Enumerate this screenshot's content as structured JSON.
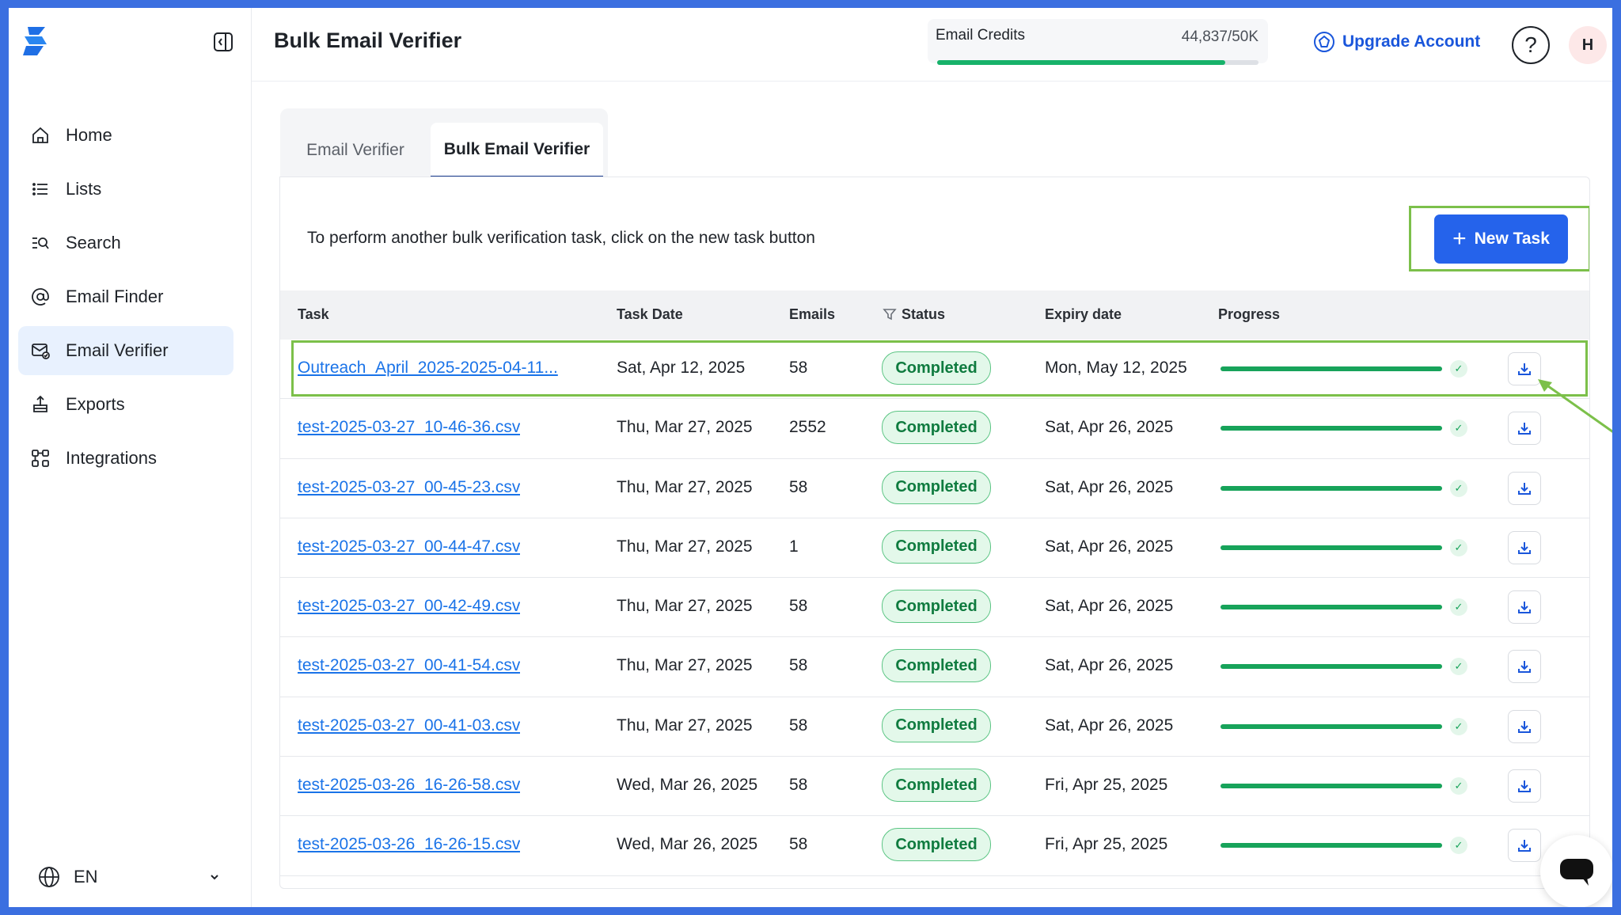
{
  "header": {
    "title": "Bulk Email Verifier",
    "credits_label": "Email Credits",
    "credits_value": "44,837/50K",
    "credits_fraction": 0.897,
    "upgrade_label": "Upgrade Account",
    "help_label": "?",
    "avatar_initial": "H"
  },
  "sidebar": {
    "items": [
      {
        "label": "Home",
        "icon": "home-icon"
      },
      {
        "label": "Lists",
        "icon": "list-icon"
      },
      {
        "label": "Search",
        "icon": "search-icon"
      },
      {
        "label": "Email Finder",
        "icon": "at-sign-icon"
      },
      {
        "label": "Email Verifier",
        "icon": "mail-check-icon",
        "active": true
      },
      {
        "label": "Exports",
        "icon": "export-icon"
      },
      {
        "label": "Integrations",
        "icon": "integrations-icon"
      }
    ],
    "language": "EN"
  },
  "tabs": [
    {
      "label": "Email Verifier",
      "active": false
    },
    {
      "label": "Bulk Email Verifier",
      "active": true
    }
  ],
  "main": {
    "intro_text": "To perform another bulk verification task, click on the new task button",
    "new_task_label": "New Task"
  },
  "table": {
    "columns": [
      "Task",
      "Task Date",
      "Emails",
      "Status",
      "Expiry date",
      "Progress"
    ],
    "rows": [
      {
        "task": "Outreach_April_2025-2025-04-11...",
        "date": "Sat, Apr 12, 2025",
        "emails": "58",
        "status": "Completed",
        "expiry": "Mon, May 12, 2025",
        "progress": 1.0
      },
      {
        "task": "test-2025-03-27_10-46-36.csv",
        "date": "Thu, Mar 27, 2025",
        "emails": "2552",
        "status": "Completed",
        "expiry": "Sat, Apr 26, 2025",
        "progress": 1.0
      },
      {
        "task": "test-2025-03-27_00-45-23.csv",
        "date": "Thu, Mar 27, 2025",
        "emails": "58",
        "status": "Completed",
        "expiry": "Sat, Apr 26, 2025",
        "progress": 1.0
      },
      {
        "task": "test-2025-03-27_00-44-47.csv",
        "date": "Thu, Mar 27, 2025",
        "emails": "1",
        "status": "Completed",
        "expiry": "Sat, Apr 26, 2025",
        "progress": 1.0
      },
      {
        "task": "test-2025-03-27_00-42-49.csv",
        "date": "Thu, Mar 27, 2025",
        "emails": "58",
        "status": "Completed",
        "expiry": "Sat, Apr 26, 2025",
        "progress": 1.0
      },
      {
        "task": "test-2025-03-27_00-41-54.csv",
        "date": "Thu, Mar 27, 2025",
        "emails": "58",
        "status": "Completed",
        "expiry": "Sat, Apr 26, 2025",
        "progress": 1.0
      },
      {
        "task": "test-2025-03-27_00-41-03.csv",
        "date": "Thu, Mar 27, 2025",
        "emails": "58",
        "status": "Completed",
        "expiry": "Sat, Apr 26, 2025",
        "progress": 1.0
      },
      {
        "task": "test-2025-03-26_16-26-58.csv",
        "date": "Wed, Mar 26, 2025",
        "emails": "58",
        "status": "Completed",
        "expiry": "Fri, Apr 25, 2025",
        "progress": 1.0
      },
      {
        "task": "test-2025-03-26_16-26-15.csv",
        "date": "Wed, Mar 26, 2025",
        "emails": "58",
        "status": "Completed",
        "expiry": "Fri, Apr 25, 2025",
        "progress": 1.0
      }
    ]
  },
  "colors": {
    "primary": "#2563eb",
    "success": "#17a35a",
    "highlight": "#7cc04a",
    "frame": "#3b6fe0"
  }
}
